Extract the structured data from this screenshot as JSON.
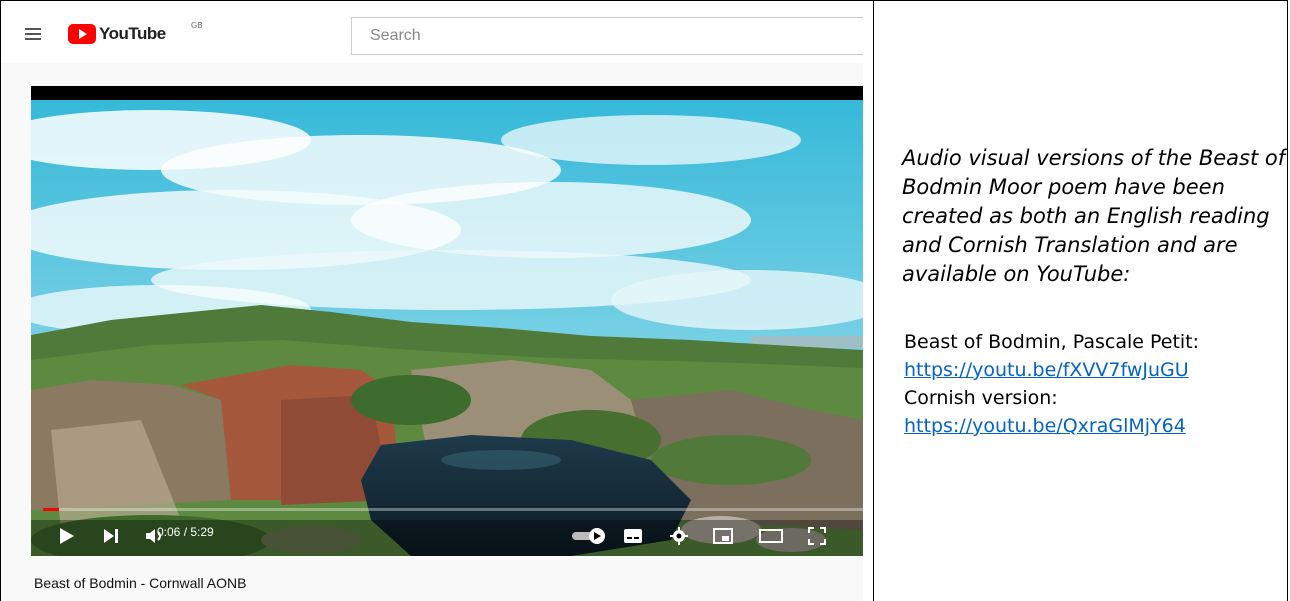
{
  "youtube": {
    "brand": "YouTube",
    "region": "GB",
    "search_placeholder": "Search"
  },
  "player": {
    "time_display": "0:06 / 5:29",
    "progress_fraction": 0.019,
    "video_title": "Beast of Bodmin - Cornwall AONB"
  },
  "panel": {
    "description": "Audio visual versions of the Beast of Bodmin Moor poem have been created as both an English reading and Cornish Translation and are available on YouTube:",
    "english_label": "Beast of Bodmin, Pascale Petit:",
    "english_link": "https://youtu.be/fXVV7fwJuGU",
    "cornish_label": "Cornish version:",
    "cornish_link": "https://youtu.be/QxraGlMjY64"
  },
  "colors": {
    "brand_red": "#ff0000",
    "link_blue": "#0563c1"
  }
}
